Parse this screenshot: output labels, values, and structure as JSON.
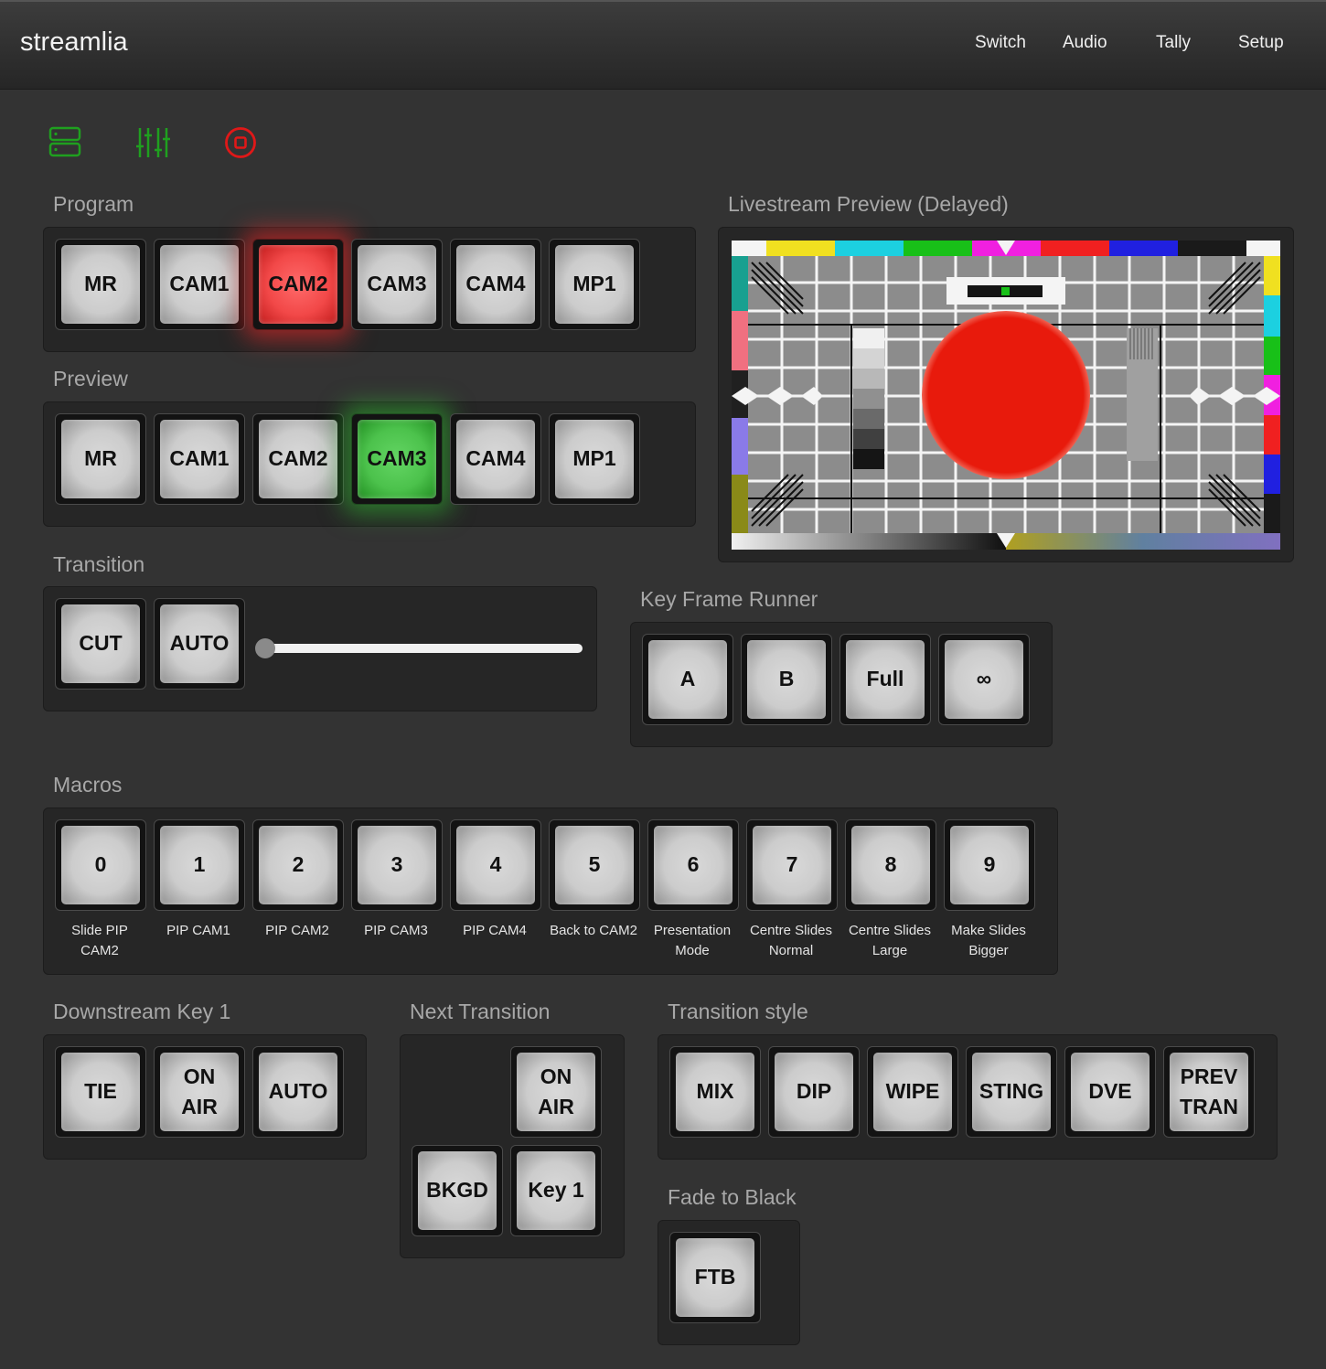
{
  "app": {
    "brand": "streamlia"
  },
  "nav": {
    "items": [
      "Switch",
      "Audio",
      "Tally",
      "Setup"
    ]
  },
  "colors": {
    "background": "#333333",
    "program_active": "#f24848",
    "preview_active": "#4cc24c",
    "icon_green": "#1fa01f",
    "icon_red": "#e01818"
  },
  "toolbar": {
    "icons": [
      "server-icon",
      "mixer-sliders-icon",
      "record-stop-icon"
    ]
  },
  "program": {
    "label": "Program",
    "buttons": [
      "MR",
      "CAM1",
      "CAM2",
      "CAM3",
      "CAM4",
      "MP1"
    ],
    "active": "CAM2"
  },
  "preview": {
    "label": "Preview",
    "buttons": [
      "MR",
      "CAM1",
      "CAM2",
      "CAM3",
      "CAM4",
      "MP1"
    ],
    "active": "CAM3"
  },
  "livestream": {
    "label": "Livestream Preview (Delayed)"
  },
  "transition": {
    "label": "Transition",
    "buttons": [
      "CUT",
      "AUTO"
    ],
    "tbar_position": 0
  },
  "keyframe": {
    "label": "Key Frame Runner",
    "buttons": [
      "A",
      "B",
      "Full",
      "∞"
    ]
  },
  "macros": {
    "label": "Macros",
    "items": [
      {
        "number": "0",
        "line1": "Slide PIP",
        "line2": "CAM2"
      },
      {
        "number": "1",
        "line1": "PIP CAM1",
        "line2": ""
      },
      {
        "number": "2",
        "line1": "PIP CAM2",
        "line2": ""
      },
      {
        "number": "3",
        "line1": "PIP CAM3",
        "line2": ""
      },
      {
        "number": "4",
        "line1": "PIP CAM4",
        "line2": ""
      },
      {
        "number": "5",
        "line1": "Back to CAM2",
        "line2": ""
      },
      {
        "number": "6",
        "line1": "Presentation",
        "line2": "Mode"
      },
      {
        "number": "7",
        "line1": "Centre Slides",
        "line2": "Normal"
      },
      {
        "number": "8",
        "line1": "Centre Slides",
        "line2": "Large"
      },
      {
        "number": "9",
        "line1": "Make Slides",
        "line2": "Bigger"
      }
    ]
  },
  "dsk": {
    "label": "Downstream Key 1",
    "tie": "TIE",
    "onair": [
      "ON",
      "AIR"
    ],
    "auto": "AUTO"
  },
  "next_transition": {
    "label": "Next Transition",
    "onair": [
      "ON",
      "AIR"
    ],
    "bkgd": "BKGD",
    "key1": "Key 1"
  },
  "transition_style": {
    "label": "Transition style",
    "buttons": [
      "MIX",
      "DIP",
      "WIPE",
      "STING",
      "DVE"
    ],
    "prev": [
      "PREV",
      "TRAN"
    ]
  },
  "ftb": {
    "label": "Fade to Black",
    "button": "FTB"
  }
}
